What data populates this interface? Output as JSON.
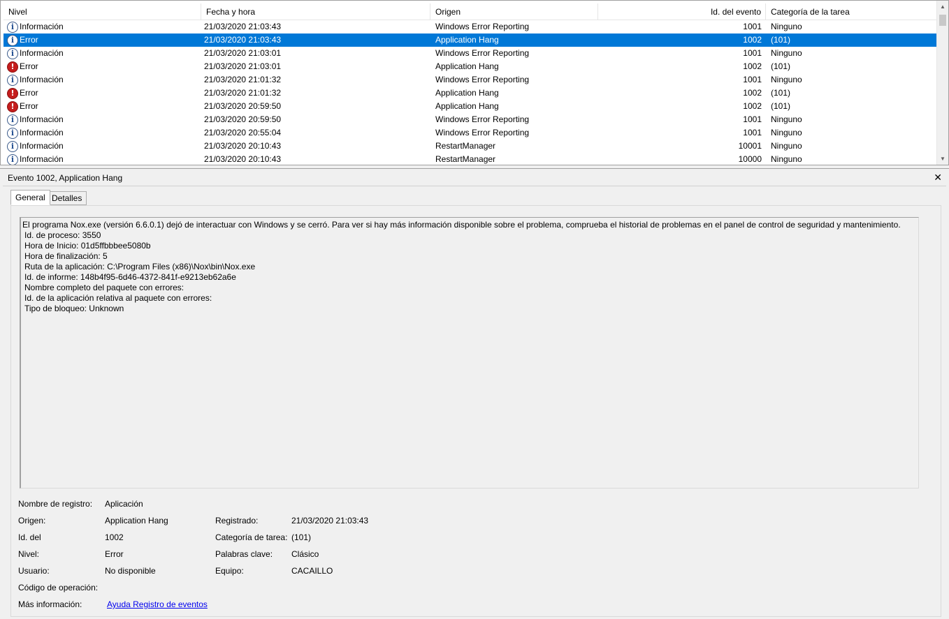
{
  "columns": {
    "level": "Nivel",
    "datetime": "Fecha y hora",
    "source": "Origen",
    "event_id": "Id. del evento",
    "task": "Categoría de la tarea"
  },
  "rows": [
    {
      "level": "Información",
      "icon": "info-icon",
      "datetime": "21/03/2020 21:03:43",
      "source": "Windows Error Reporting",
      "event_id": "1001",
      "task": "Ninguno",
      "selected": false
    },
    {
      "level": "Error",
      "icon": "info-icon",
      "datetime": "21/03/2020 21:03:43",
      "source": "Application Hang",
      "event_id": "1002",
      "task": "(101)",
      "selected": true
    },
    {
      "level": "Información",
      "icon": "info-icon",
      "datetime": "21/03/2020 21:03:01",
      "source": "Windows Error Reporting",
      "event_id": "1001",
      "task": "Ninguno",
      "selected": false
    },
    {
      "level": "Error",
      "icon": "error-icon",
      "datetime": "21/03/2020 21:03:01",
      "source": "Application Hang",
      "event_id": "1002",
      "task": "(101)",
      "selected": false
    },
    {
      "level": "Información",
      "icon": "info-icon",
      "datetime": "21/03/2020 21:01:32",
      "source": "Windows Error Reporting",
      "event_id": "1001",
      "task": "Ninguno",
      "selected": false
    },
    {
      "level": "Error",
      "icon": "error-icon",
      "datetime": "21/03/2020 21:01:32",
      "source": "Application Hang",
      "event_id": "1002",
      "task": "(101)",
      "selected": false
    },
    {
      "level": "Error",
      "icon": "error-icon",
      "datetime": "21/03/2020 20:59:50",
      "source": "Application Hang",
      "event_id": "1002",
      "task": "(101)",
      "selected": false
    },
    {
      "level": "Información",
      "icon": "info-icon",
      "datetime": "21/03/2020 20:59:50",
      "source": "Windows Error Reporting",
      "event_id": "1001",
      "task": "Ninguno",
      "selected": false
    },
    {
      "level": "Información",
      "icon": "info-icon",
      "datetime": "21/03/2020 20:55:04",
      "source": "Windows Error Reporting",
      "event_id": "1001",
      "task": "Ninguno",
      "selected": false
    },
    {
      "level": "Información",
      "icon": "info-icon",
      "datetime": "21/03/2020 20:10:43",
      "source": "RestartManager",
      "event_id": "10001",
      "task": "Ninguno",
      "selected": false
    },
    {
      "level": "Información",
      "icon": "info-icon",
      "datetime": "21/03/2020 20:10:43",
      "source": "RestartManager",
      "event_id": "10000",
      "task": "Ninguno",
      "selected": false
    }
  ],
  "detail": {
    "title": "Evento 1002, Application Hang",
    "close": "✕",
    "tabs": {
      "general": "General",
      "details": "Detalles"
    },
    "message": [
      "El programa Nox.exe (versión 6.6.0.1) dejó de interactuar con Windows y se cerró. Para ver si hay más información disponible sobre el problema, comprueba el historial de problemas en el panel de control de seguridad y mantenimiento.",
      "Id. de proceso: 3550",
      "Hora de Inicio: 01d5ffbbbee5080b",
      "Hora de finalización: 5",
      "Ruta de la aplicación: C:\\Program Files (x86)\\Nox\\bin\\Nox.exe",
      "Id. de informe: 148b4f95-6d46-4372-841f-e9213eb62a6e",
      "Nombre completo del paquete con errores:",
      "Id. de la aplicación relativa al paquete con errores:",
      "Tipo de bloqueo: Unknown"
    ],
    "props": {
      "log_name_label": "Nombre de registro:",
      "log_name": "Aplicación",
      "source_label": "Origen:",
      "source": "Application Hang",
      "logged_label": "Registrado:",
      "logged": "21/03/2020 21:03:43",
      "event_id_label": "Id. del",
      "event_id": "1002",
      "task_label": "Categoría de tarea:",
      "task": "(101)",
      "level_label": "Nivel:",
      "level": "Error",
      "keywords_label": "Palabras clave:",
      "keywords": "Clásico",
      "user_label": "Usuario:",
      "user": "No disponible",
      "computer_label": "Equipo:",
      "computer": "CACAILLO",
      "opcode_label": "Código de operación:",
      "more_info_label": "Más información:",
      "more_info_link": "Ayuda Registro de eventos"
    }
  }
}
